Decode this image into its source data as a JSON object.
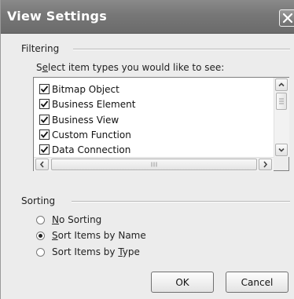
{
  "window": {
    "title": "View Settings",
    "close_icon": "close-icon"
  },
  "filtering": {
    "group_label": "Filtering",
    "prompt_prefix": "S",
    "prompt_underlined": "e",
    "prompt_rest": "lect item types you would like to see:",
    "items": [
      {
        "label": "Bitmap Object",
        "checked": true
      },
      {
        "label": "Business Element",
        "checked": true
      },
      {
        "label": "Business View",
        "checked": true
      },
      {
        "label": "Custom Function",
        "checked": true
      },
      {
        "label": "Data Connection",
        "checked": true
      }
    ]
  },
  "sorting": {
    "group_label": "Sorting",
    "options": [
      {
        "underlined": "N",
        "rest": "o Sorting",
        "prefix": "",
        "selected": false
      },
      {
        "underlined": "S",
        "rest": "ort Items by Name",
        "prefix": "",
        "selected": true
      },
      {
        "prefix": "Sort Items by ",
        "underlined": "T",
        "rest": "ype",
        "selected": false
      }
    ]
  },
  "buttons": {
    "ok_label": "OK",
    "cancel_label": "Cancel"
  }
}
